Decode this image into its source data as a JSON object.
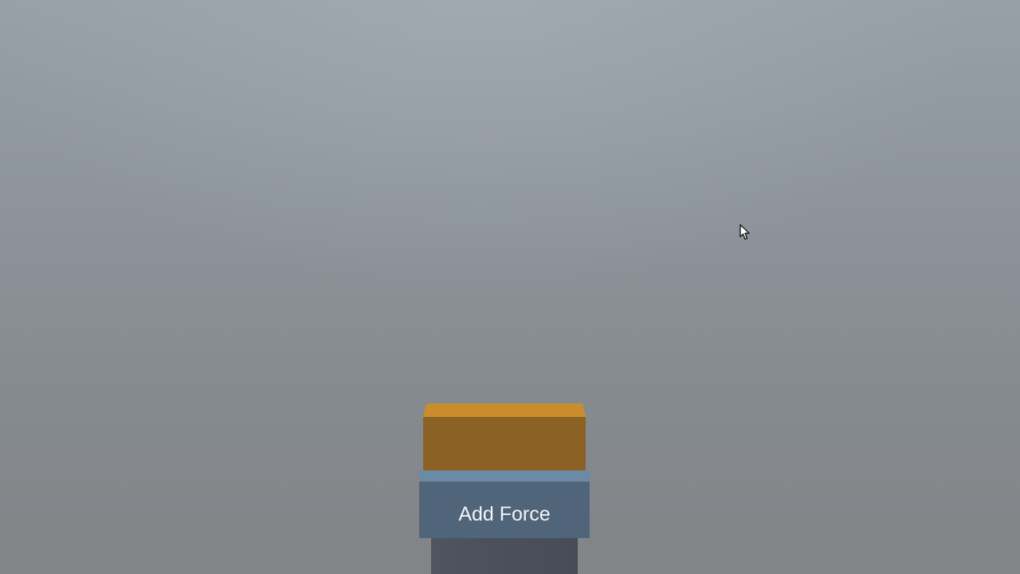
{
  "scene": {
    "background_color": "#8d949b"
  },
  "box": {
    "color_top": "#c98d2e",
    "color_front": "#8c6125"
  },
  "platform": {
    "button_label": "Add Force",
    "button_color": "#50657a",
    "top_color": "#6b8aa6",
    "pillar_color": "#4a505a"
  },
  "cursor": {
    "icon": "mouse-pointer-icon"
  }
}
